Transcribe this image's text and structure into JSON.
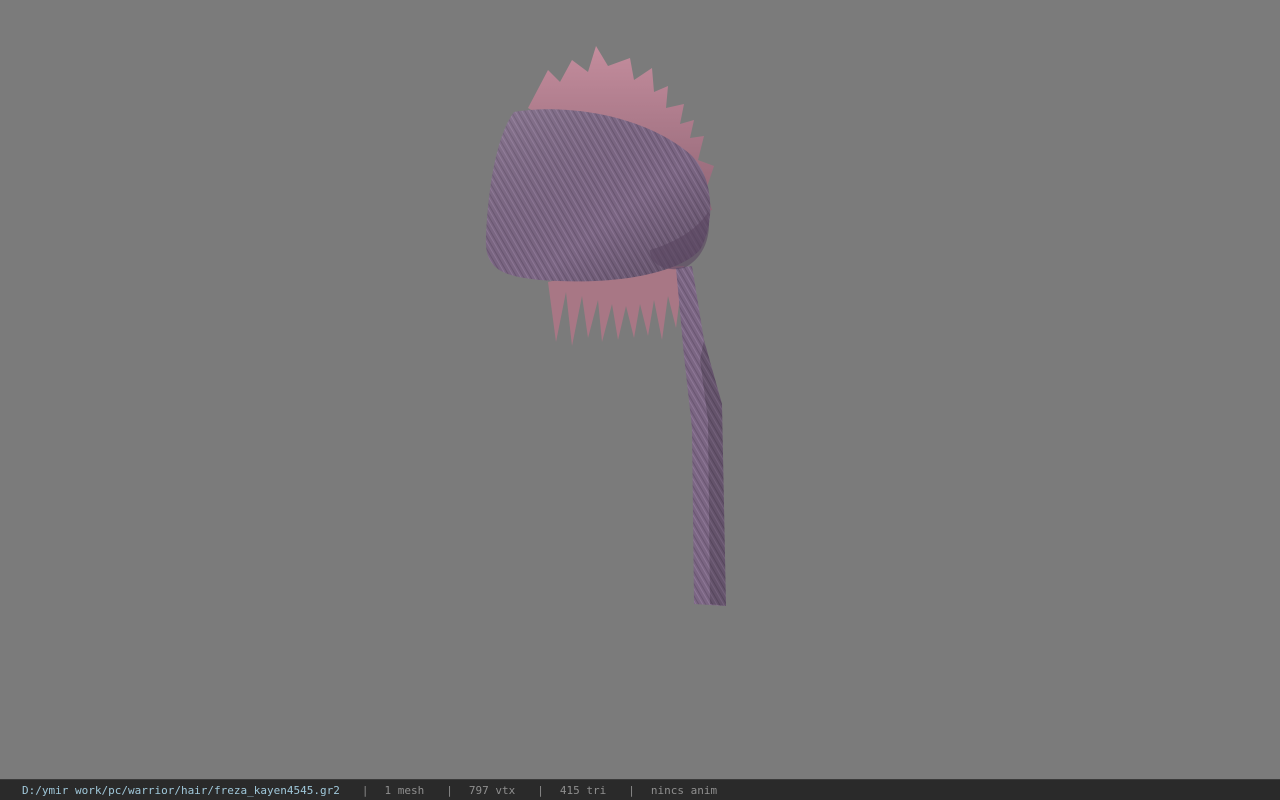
{
  "viewport": {
    "background": "#7b7b7b",
    "model": {
      "description_icon": "hair-mesh-model",
      "cloth_color": "#7a6680",
      "spike_color": "#b07f8f"
    }
  },
  "status": {
    "file_path": "D:/ymir work/pc/warrior/hair/freza_kayen4545.gr2",
    "separator": "|",
    "mesh_count": "1 mesh",
    "vertex_count": "797 vtx",
    "triangle_count": "415 tri",
    "animation": "nincs anim"
  }
}
